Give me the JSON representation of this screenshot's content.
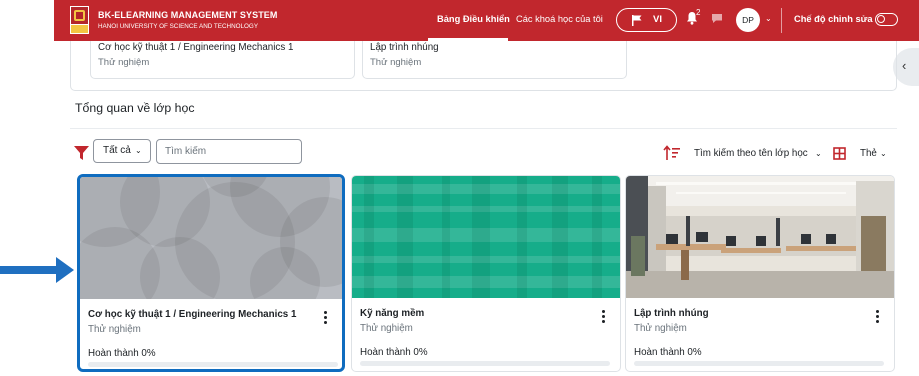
{
  "header": {
    "brand_title": "BK-ELEARNING MANAGEMENT SYSTEM",
    "brand_subtitle": "HANOI UNIVERSITY OF SCIENCE AND TECHNOLOGY",
    "nav": [
      {
        "label": "Bảng Điều khiển",
        "active": true
      },
      {
        "label": "Các khoá học của tôi",
        "active": false
      }
    ],
    "language": "VI",
    "notification_count": "2",
    "avatar_initials": "DP",
    "edit_mode_label": "Chế độ chỉnh sửa",
    "edit_mode_on": false,
    "brand_color": "#c1272d"
  },
  "recent": [
    {
      "title": "Cơ học kỹ thuật 1 / Engineering Mechanics 1",
      "subtitle": "Thử nghiệm"
    },
    {
      "title": "Lập trình nhúng",
      "subtitle": "Thử nghiệm"
    }
  ],
  "overview": {
    "title": "Tổng quan về lớp học",
    "filter_select": "Tất cả",
    "search_placeholder": "Tìm kiếm",
    "sort_label": "Tìm kiếm theo tên lớp học",
    "view_label": "Thẻ"
  },
  "courses": [
    {
      "title": "Cơ học kỹ thuật 1 / Engineering Mechanics 1",
      "category": "Thử nghiệm",
      "progress_label": "Hoàn thành 0%",
      "progress": 0,
      "image": "grey-circles-pattern",
      "selected": true
    },
    {
      "title": "Kỹ năng mềm",
      "category": "Thử nghiệm",
      "progress_label": "Hoàn thành 0%",
      "progress": 0,
      "image": "green-plaid-pattern",
      "selected": false
    },
    {
      "title": "Lập trình nhúng",
      "category": "Thử nghiệm",
      "progress_label": "Hoàn thành 0%",
      "progress": 0,
      "image": "office-interior-photo",
      "selected": false
    }
  ],
  "colors": {
    "accent": "#0f6cbf",
    "filter_icon": "#c1272d"
  }
}
